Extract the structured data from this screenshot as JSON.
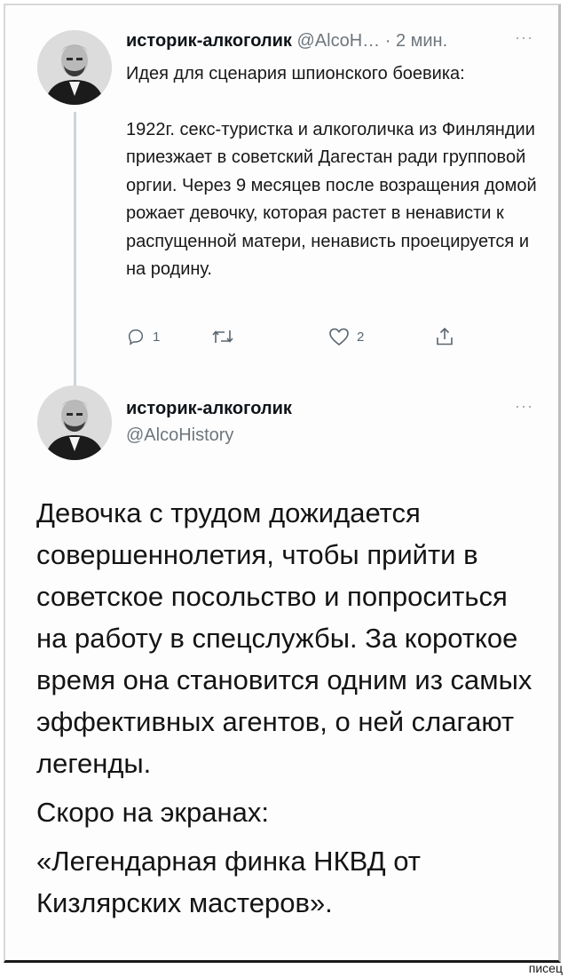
{
  "tweet1": {
    "author_name": "историк-алкоголик",
    "handle_short": "@AlcoH…",
    "separator": "·",
    "time": "2 мин.",
    "more": "···",
    "text": [
      "Идея для сценария шпионского боевика:",
      "1922г. секс-туристка и алкоголичка из Финляндии приезжает в советский Дагестан ради групповой оргии. Через 9 месяцев после возращения домой рожает девочку, которая растет в ненависти к распущенной матери, ненависть проецируется и на родину."
    ],
    "actions": {
      "reply_icon": "reply-icon",
      "reply_count": "1",
      "retweet_icon": "retweet-icon",
      "like_icon": "heart-icon",
      "like_count": "2",
      "share_icon": "share-icon"
    }
  },
  "tweet2": {
    "author_name": "историк-алкоголик",
    "handle": "@AlcoHistory",
    "more": "···",
    "text": [
      "Девочка с трудом дожидается совершеннолетия, чтобы прийти в советское посольство и попроситься на работу в спецслужбы. За короткое время она становится одним из самых эффективных агентов, о ней слагают легенды.",
      "Скоро на экранах:",
      "«Легендарная финка НКВД от Кизлярских мастеров»."
    ]
  },
  "watermark": "писец",
  "colors": {
    "text": "#141414",
    "secondary": "#6e767d",
    "thread_line": "#cfd4d8",
    "icon": "#5b6670"
  }
}
